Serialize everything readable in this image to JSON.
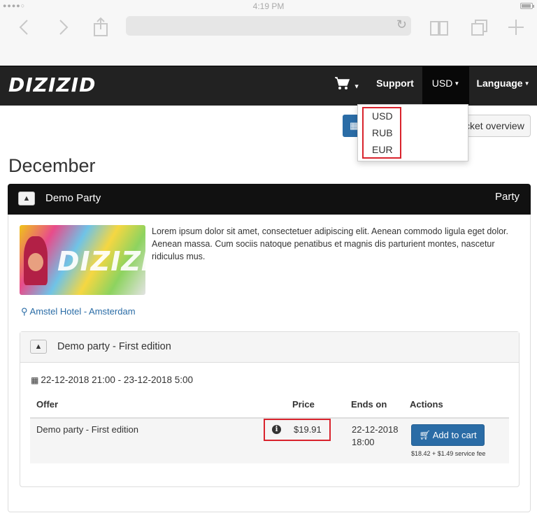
{
  "status_bar": {
    "signal": "●●●●○",
    "time": "4:19 PM"
  },
  "browser": {
    "back_icon": "chevron-left-icon",
    "forward_icon": "chevron-right-icon",
    "share_icon": "share-icon",
    "reload_icon": "reload-icon",
    "bookmarks_icon": "book-icon",
    "tabs_icon": "tabs-icon",
    "new_tab_icon": "plus-icon"
  },
  "navbar": {
    "logo": "DIZIZID",
    "support_label": "Support",
    "currency_label": "USD",
    "language_label": "Language"
  },
  "currency_dropdown": {
    "options": [
      "USD",
      "RUB",
      "EUR"
    ]
  },
  "toolbar": {
    "overview_label": "cket overview"
  },
  "page": {
    "month": "December"
  },
  "event": {
    "title": "Demo Party",
    "tag": "Party",
    "image_text": "DIZIZID",
    "description": "Lorem ipsum dolor sit amet, consectetuer adipiscing elit. Aenean commodo ligula eget dolor. Aenean massa. Cum sociis natoque penatibus et magnis dis parturient montes, nascetur ridiculus mus.",
    "location": "Amstel Hotel - Amsterdam"
  },
  "edition": {
    "title": "Demo party - First edition",
    "date_range": "22-12-2018 21:00 - 23-12-2018 5:00",
    "columns": {
      "offer": "Offer",
      "price": "Price",
      "ends_on": "Ends on",
      "actions": "Actions"
    },
    "row": {
      "offer": "Demo party - First edition",
      "price": "$19.91",
      "ends_date": "22-12-2018",
      "ends_time": "18:00",
      "add_label": "Add to cart",
      "fee": "$18.42 + $1.49 service fee"
    }
  },
  "colors": {
    "navbar_bg": "#222222",
    "primary": "#2a6ca6",
    "highlight": "#d9232d"
  }
}
